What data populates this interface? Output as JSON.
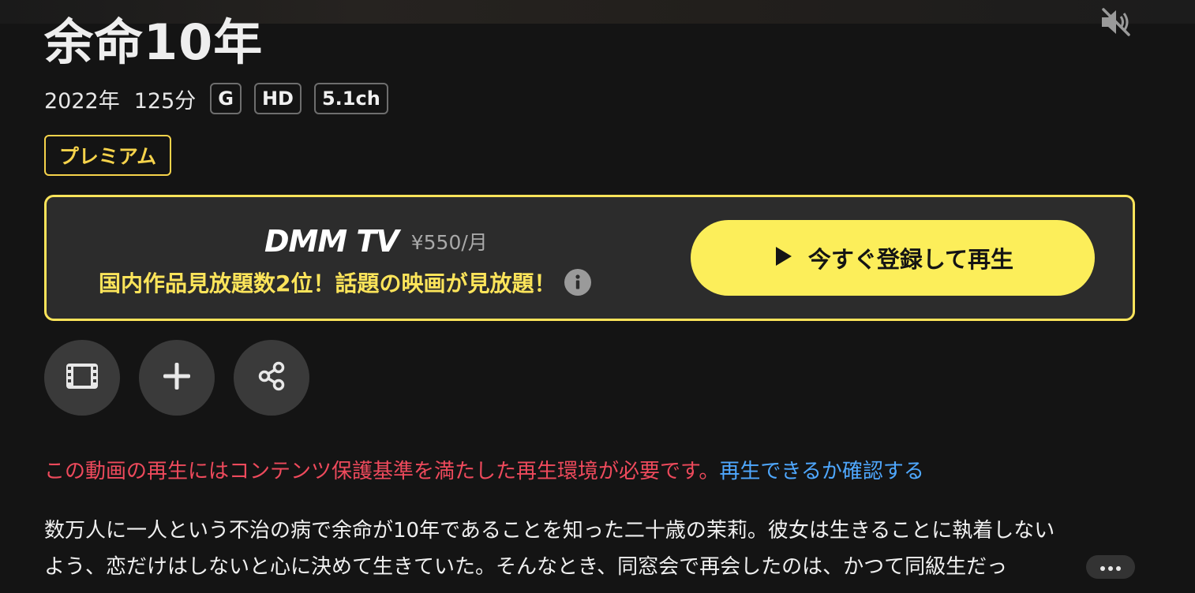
{
  "title": "余命10年",
  "meta": {
    "year": "2022年",
    "duration": "125分",
    "badges": [
      "G",
      "HD",
      "5.1ch"
    ]
  },
  "premium_label": "プレミアム",
  "promo": {
    "logo_text": "DMM TV",
    "price": "¥550/月",
    "subtitle": "国内作品見放題数2位！話題の映画が見放題！",
    "cta_label": "今すぐ登録して再生",
    "cta_icon": "play-icon",
    "info_icon": "info-icon",
    "accent_color": "#fce45a"
  },
  "actions": [
    {
      "name": "trailer",
      "icon": "film-icon"
    },
    {
      "name": "add-to-list",
      "icon": "plus-icon"
    },
    {
      "name": "share",
      "icon": "share-icon"
    }
  ],
  "drm_notice": {
    "warning": "この動画の再生にはコンテンツ保護基準を満たした再生環境が必要です。",
    "link": "再生できるか確認する",
    "warning_color": "#ee4a5c",
    "link_color": "#4fa8ff"
  },
  "synopsis": {
    "line1": "数万人に一人という不治の病で余命が10年であることを知った二十歳の茉莉。彼女は生きることに執着しない",
    "line2": "よう、恋だけはしないと心に決めて生きていた。そんなとき、同窓会で再会したのは、かつて同級生だっ",
    "more_icon": "more-icon"
  },
  "mute_icon": "mute-icon"
}
